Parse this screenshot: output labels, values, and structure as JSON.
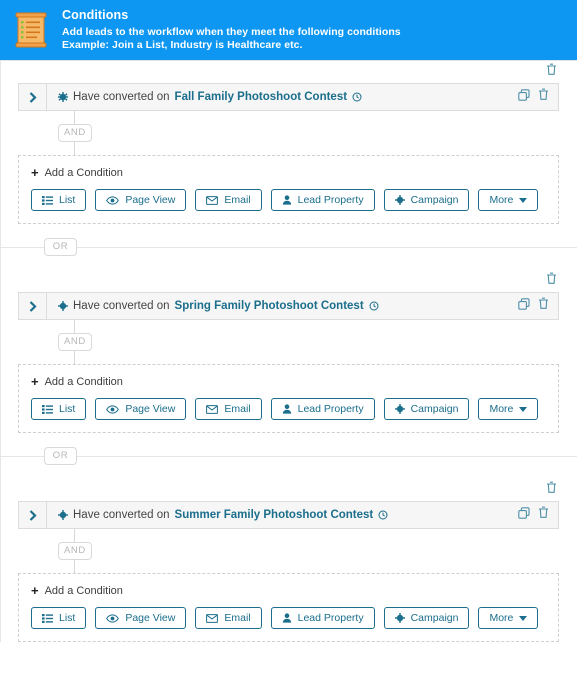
{
  "header": {
    "icon": "scroll-list-icon",
    "title": "Conditions",
    "subtitle_line1": "Add leads to the workflow when they meet the following conditions",
    "subtitle_line2": "Example: Join a List, Industry is Healthcare etc.",
    "background_color": "#0d97f2",
    "text_color": "#ffffff"
  },
  "colors": {
    "accent": "#1b6e8c",
    "header_blue": "#0d97f2",
    "row_background": "#f6f6f6",
    "row_border": "#dcdcdc",
    "badge_text": "#b6b6b6",
    "icon_orange": "#e8821e"
  },
  "labels": {
    "and": "AND",
    "or": "OR",
    "add_condition": "Add a Condition",
    "plus": "+",
    "condition_verb": "Have converted on"
  },
  "action_buttons": [
    {
      "label": "List",
      "icon": "list-icon"
    },
    {
      "label": "Page View",
      "icon": "eye-icon"
    },
    {
      "label": "Email",
      "icon": "envelope-icon"
    },
    {
      "label": "Lead Property",
      "icon": "person-icon"
    },
    {
      "label": "Campaign",
      "icon": "gear-icon"
    },
    {
      "label": "More",
      "icon": "chevron-down-icon"
    }
  ],
  "row_icons": {
    "expand": "chevron-right-icon",
    "bullet": "gear-icon",
    "info": "info-clock-icon",
    "duplicate": "copy-icon",
    "delete": "trash-icon",
    "group_delete": "trash-icon"
  },
  "groups": [
    {
      "condition_text": "Fall Family Photoshoot Contest",
      "operator": "AND",
      "separator_after": "OR"
    },
    {
      "condition_text": "Spring Family Photoshoot Contest",
      "operator": "AND",
      "separator_after": "OR"
    },
    {
      "condition_text": "Summer Family Photoshoot Contest",
      "operator": "AND",
      "separator_after": ""
    }
  ]
}
